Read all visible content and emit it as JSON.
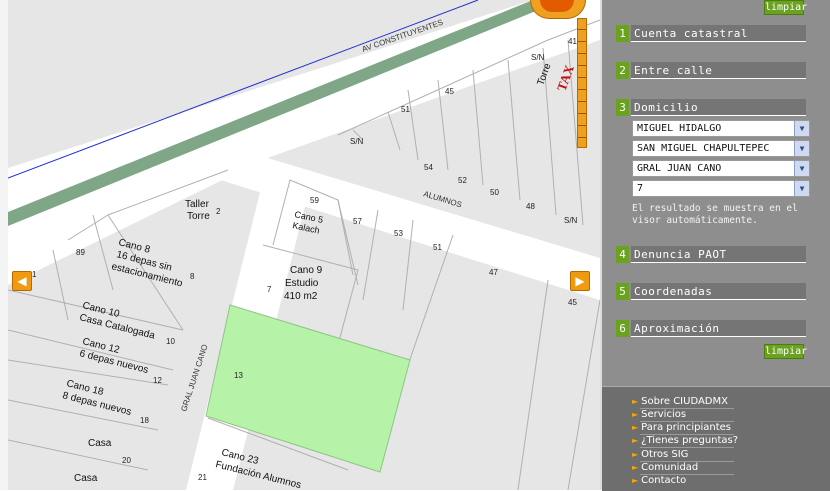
{
  "map": {
    "street_labels": {
      "av_constituyentes": "AV CONSTITUYENTES",
      "alumnos": "ALUMNOS",
      "gral_juan_cano": "GRAL JUAN CANO"
    },
    "lot_numbers": [
      "41",
      "S/N",
      "45",
      "51",
      "S/N",
      "54",
      "52",
      "50",
      "48",
      "S/N",
      "59",
      "57",
      "53",
      "51",
      "47",
      "45",
      "2",
      "89",
      "8",
      "7",
      "1",
      "10",
      "12",
      "18",
      "20",
      "21",
      "13"
    ],
    "building_labels": {
      "torre_tax": "Torre",
      "tax_sign": "TAX",
      "taller_torre_1": "Taller",
      "taller_torre_2": "Torre",
      "cano5_1": "Cano 5",
      "cano5_2": "Kalach",
      "cano8_1": "Cano 8",
      "cano8_2": "16 depas sin",
      "cano8_3": "estacionamiento",
      "cano9_1": "Cano 9",
      "cano9_2": "Estudio",
      "cano9_3": "410 m2",
      "cano10_1": "Cano 10",
      "cano10_2": "Casa Catalogada",
      "cano12_1": "Cano 12",
      "cano12_2": "6 depas nuevos",
      "cano18_1": "Cano 18",
      "cano18_2": "8 depas nuevos",
      "casa_1": "Casa",
      "casa_2": "Casa",
      "cano23_1": "Cano 23",
      "cano23_2": "Fundación Alumnos"
    },
    "colors": {
      "road_green": "#7fa787",
      "highlight_lot": "#b6f2a8",
      "av_line": "#2233cc"
    }
  },
  "panel": {
    "clear_top": "limpiar",
    "clear_bottom": "limpiar",
    "sections": [
      {
        "num": "1",
        "label": "Cuenta catastral"
      },
      {
        "num": "2",
        "label": "Entre calle"
      },
      {
        "num": "3",
        "label": "Domicilio"
      },
      {
        "num": "4",
        "label": "Denuncia PAOT"
      },
      {
        "num": "5",
        "label": "Coordenadas"
      },
      {
        "num": "6",
        "label": "Aproximación"
      }
    ],
    "address": {
      "delegacion": "MIGUEL HIDALGO",
      "colonia": "SAN MIGUEL CHAPULTEPEC",
      "calle": "GRAL JUAN CANO",
      "numero": "7"
    },
    "note": "El resultado se muestra en el visor automáticamente."
  },
  "links": [
    "Sobre CIUDADMX",
    "Servicios",
    "Para principiantes",
    "¿Tienes preguntas?",
    "Otros SIG",
    "Comunidad",
    "Contacto"
  ]
}
